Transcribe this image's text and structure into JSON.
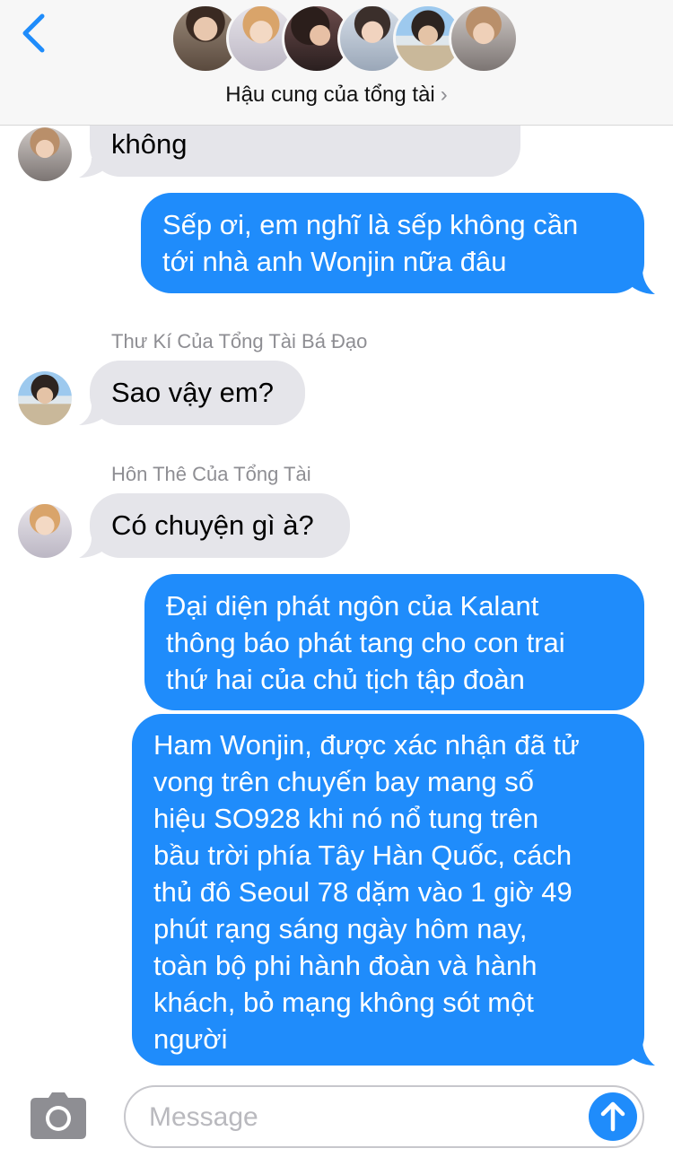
{
  "header": {
    "group_name": "Hậu cung của tổng tài",
    "chevron": "›",
    "avatar_count": 6
  },
  "messages": [
    {
      "direction": "incoming",
      "text": "không"
    },
    {
      "direction": "outgoing",
      "lines": [
        "Sếp ơi, em nghĩ là sếp không cần",
        "tới nhà anh Wonjin nữa đâu"
      ]
    },
    {
      "direction": "incoming",
      "sender": "Thư Kí Của Tổng Tài Bá Đạo",
      "text": "Sao vậy em?"
    },
    {
      "direction": "incoming",
      "sender": "Hôn Thê Của Tổng Tài",
      "text": "Có chuyện gì à?"
    },
    {
      "direction": "outgoing",
      "lines": [
        "Đại diện phát ngôn của Kalant",
        "thông báo phát tang cho con trai",
        "thứ hai của chủ tịch tập đoàn"
      ]
    },
    {
      "direction": "outgoing",
      "lines": [
        "Ham Wonjin, được xác nhận đã tử",
        "vong trên chuyến bay mang số",
        "hiệu SO928 khi nó nổ tung trên",
        "bầu trời phía Tây Hàn Quốc, cách",
        "thủ đô Seoul 78 dặm vào 1 giờ 49",
        "phút rạng sáng ngày hôm nay,",
        "toàn bộ phi hành đoàn và hành",
        "khách, bỏ mạng không sót một",
        "người"
      ]
    }
  ],
  "input": {
    "placeholder": "Message"
  },
  "colors": {
    "accent": "#1f8cfb",
    "incoming_bubble": "#e5e5ea",
    "header_bg": "#f7f7f7",
    "secondary_text": "#8e8e93"
  },
  "icons": [
    "back-chevron-icon",
    "camera-icon",
    "send-arrow-icon"
  ]
}
